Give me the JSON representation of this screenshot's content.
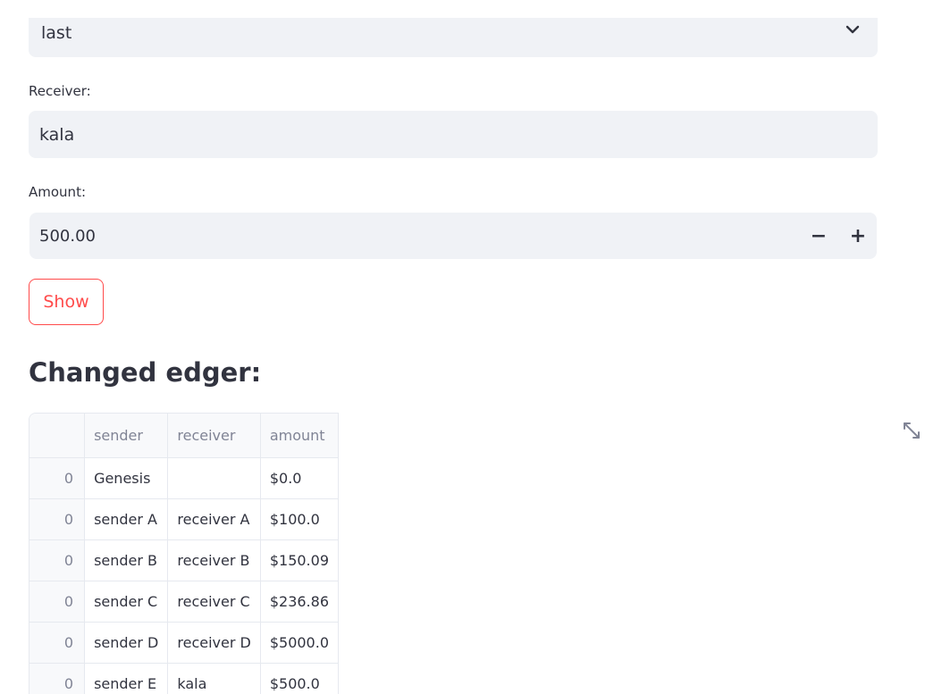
{
  "form": {
    "select_value": "last",
    "receiver_label": "Receiver:",
    "receiver_value": "kala",
    "amount_label": "Amount:",
    "amount_value": "500.00",
    "minus_label": "−",
    "plus_label": "+",
    "show_button": "Show"
  },
  "ledger": {
    "title": "Changed edger:",
    "columns": [
      "",
      "sender",
      "receiver",
      "amount"
    ],
    "rows": [
      {
        "index": "0",
        "sender": "Genesis",
        "receiver": "",
        "amount": "$0.0"
      },
      {
        "index": "0",
        "sender": "sender A",
        "receiver": "receiver A",
        "amount": "$100.0"
      },
      {
        "index": "0",
        "sender": "sender B",
        "receiver": "receiver B",
        "amount": "$150.09"
      },
      {
        "index": "0",
        "sender": "sender C",
        "receiver": "receiver C",
        "amount": "$236.86"
      },
      {
        "index": "0",
        "sender": "sender D",
        "receiver": "receiver D",
        "amount": "$5000.0"
      },
      {
        "index": "0",
        "sender": "sender E",
        "receiver": "kala",
        "amount": "$500.0"
      }
    ]
  },
  "icons": {
    "chevron": "chevron-down-icon",
    "fullscreen": "fullscreen-expand-icon"
  },
  "colors": {
    "accent": "#ff4b4b",
    "input_bg": "#f0f2f6",
    "text": "#31333f",
    "muted": "#808495"
  }
}
